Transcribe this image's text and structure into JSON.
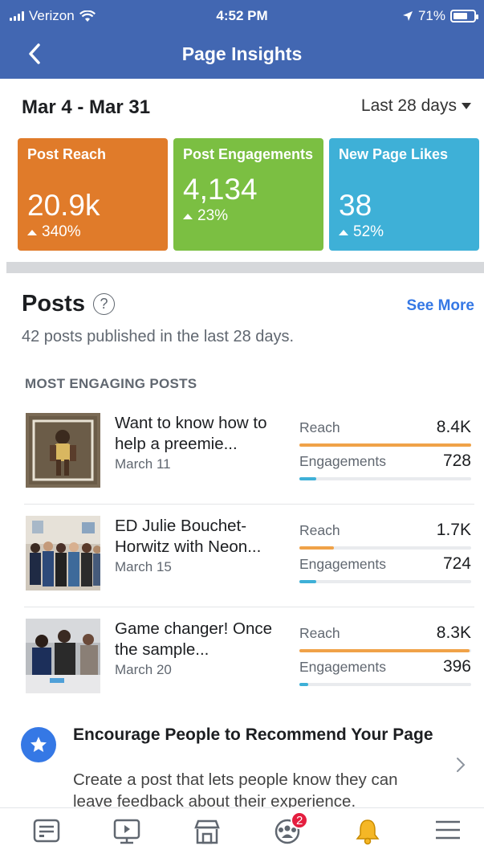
{
  "status_bar": {
    "carrier": "Verizon",
    "time": "4:52 PM",
    "battery": "71%",
    "battery_level": 0.71
  },
  "header": {
    "title": "Page Insights",
    "back_icon": "chevron-left-icon"
  },
  "date_range": {
    "range": "Mar 4 - Mar 31",
    "period": "Last 28 days"
  },
  "summary_cards": [
    {
      "label": "Post Reach",
      "value": "20.9k",
      "change": "340%",
      "color": "#e07b2a"
    },
    {
      "label": "Post Engagements",
      "value": "4,134",
      "change": "23%",
      "color": "#7bbf42"
    },
    {
      "label": "New Page Likes",
      "value": "38",
      "change": "52%",
      "color": "#3eb0d7"
    }
  ],
  "posts_section": {
    "title": "Posts",
    "see_more": "See More",
    "subtitle": "42 posts published in the last 28 days.",
    "heading": "MOST ENGAGING POSTS",
    "reach_color": "#f0a248",
    "engagement_color": "#3eb0d7",
    "items": [
      {
        "title": "Want to know how to help a preemie...",
        "date": "March 11",
        "reach_label": "Reach",
        "reach": "8.4K",
        "reach_level": 1.0,
        "eng_label": "Engagements",
        "engagements": "728",
        "eng_level": 0.1
      },
      {
        "title": "ED Julie Bouchet-Horwitz with Neon...",
        "date": "March 15",
        "reach_label": "Reach",
        "reach": "1.7K",
        "reach_level": 0.2,
        "eng_label": "Engagements",
        "engagements": "724",
        "eng_level": 0.1
      },
      {
        "title": "Game changer! Once the sample...",
        "date": "March 20",
        "reach_label": "Reach",
        "reach": "8.3K",
        "reach_level": 0.99,
        "eng_label": "Engagements",
        "engagements": "396",
        "eng_level": 0.05
      }
    ]
  },
  "recommend": {
    "title": "Encourage People to Recommend Your Page",
    "body": "Create a post that lets people know they can leave feedback about their experience.",
    "icon": "star-icon"
  },
  "tab_bar": {
    "items": [
      "news-feed-icon",
      "watch-icon",
      "marketplace-icon",
      "groups-icon",
      "notifications-icon",
      "menu-icon"
    ],
    "groups_badge": "2"
  }
}
